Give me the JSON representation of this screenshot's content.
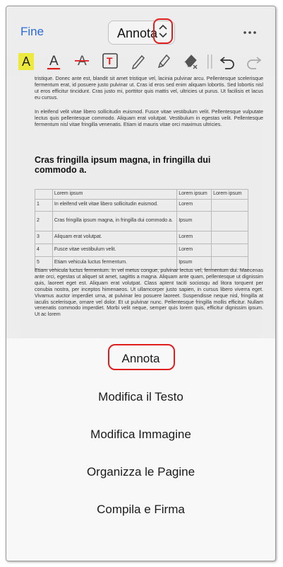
{
  "header": {
    "done_label": "Fine",
    "mode_label": "Annota"
  },
  "toolbar": {
    "highlight_letter": "A",
    "text_color_letter": "A",
    "strike_letter": "A",
    "textbox_letter": "T",
    "accent_red": "#e01e1e",
    "highlight_yellow": "#ecea3c",
    "icons": [
      "highlight-icon",
      "text-color-icon",
      "strikethrough-icon",
      "textbox-icon",
      "pen-icon",
      "marker-icon",
      "eraser-icon",
      "undo-icon",
      "redo-icon"
    ]
  },
  "document": {
    "para1": "tristique. Donec ante est, blandit sit amet tristique vel, lacinia pulvinar arcu. Pellentesque scelerisque fermentum erat, id posuere justo pulvinar ut. Cras id eros sed enim aliquam lobortis. Sed lobortis nisl ut eros efficitur tincidunt. Cras justo mi, porttitor quis mattis vel, ultricies ut purus. Ut facilisis et lacus eu cursus.",
    "para2": "In eleifend velit vitae libero sollicitudin euismod. Fusce vitae vestibulum velit. Pellentesque vulputate lectus quis pellentesque commodo. Aliquam erat volutpat. Vestibulum in egestas velit. Pellentesque fermentum nisl vitae fringilla venenatis. Etiam id mauris vitae orci maximus ultricies.",
    "heading": "Cras fringilla ipsum magna, in fringilla dui commodo a.",
    "table": {
      "header": [
        "",
        "Lorem ipsum",
        "Lorem ipsum",
        "Lorem ipsum"
      ],
      "rows": [
        [
          "1",
          "In eleifend velit vitae libero sollicitudin euismod.",
          "Lorem",
          ""
        ],
        [
          "2",
          "Cras fringilla ipsum magna, in fringilla dui commodo a.",
          "Ipsum",
          ""
        ],
        [
          "3",
          "Aliquam erat volutpat.",
          "Lorem",
          ""
        ],
        [
          "4",
          "Fusce vitae vestibulum velit.",
          "Lorem",
          ""
        ],
        [
          "5",
          "Etiam vehicula luctus fermentum.",
          "Ipsum",
          ""
        ]
      ]
    },
    "para3": "Etiam vehicula luctus fermentum. In vel metus congue, pulvinar lectus vel, fermentum dui. Maecenas ante orci, egestas ut aliquet sit amet, sagittis a magna. Aliquam ante quam, pellentesque ut dignissim quis, laoreet eget est. Aliquam erat volutpat. Class aptent taciti sociosqu ad litora torquent per conubia nostra, per inceptos himenaeos. Ut ullamcorper justo sapien, in cursus libero viverra eget. Vivamus auctor imperdiet urna, at pulvinar leo posuere laoreet. Suspendisse neque nisl, fringilla at iaculis scelerisque, ornare vel dolor. Et ut pulvinar nunc. Pellentesque fringilla mollis efficitur. Nullam venenatis commodo imperdiet. Morbi velit neque, semper quis lorem quis, efficitur dignissim ipsum. Ut ac lorem"
  },
  "menu": {
    "items": [
      "Annota",
      "Modifica il Testo",
      "Modifica Immagine",
      "Organizza le Pagine",
      "Compila e Firma"
    ]
  }
}
